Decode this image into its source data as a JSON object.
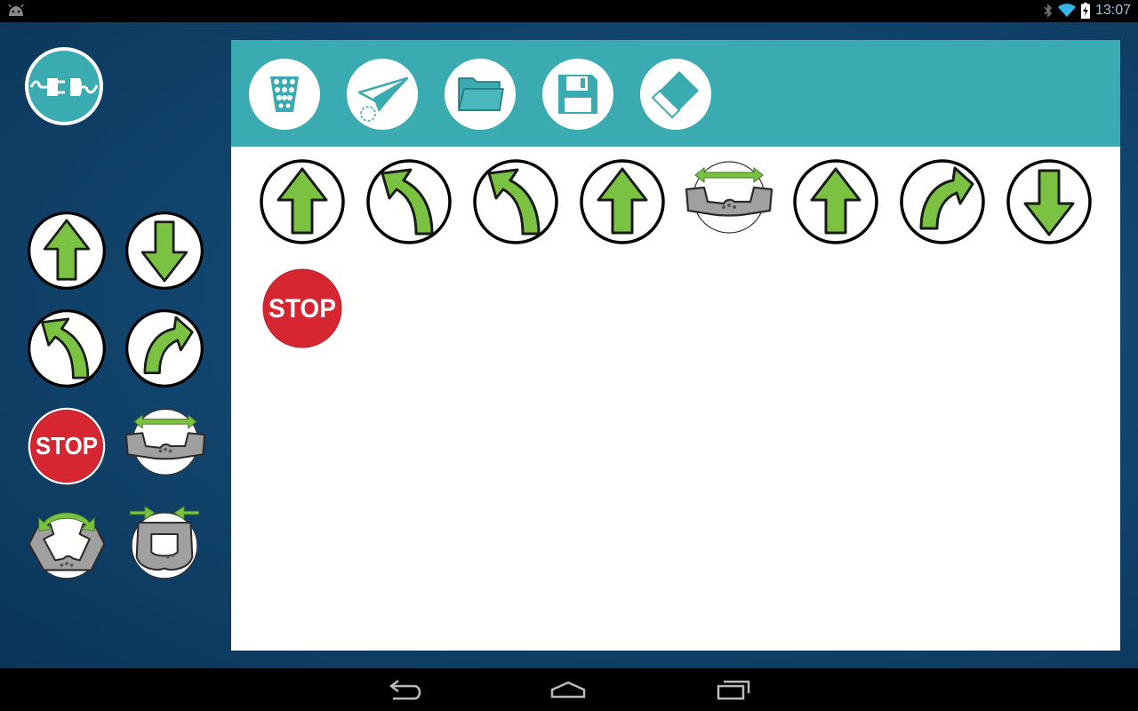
{
  "status_bar": {
    "time": "13:07",
    "icons": [
      "android-icon",
      "bluetooth-icon",
      "wifi-icon",
      "battery-icon"
    ]
  },
  "connect": {
    "icon": "plug-icon"
  },
  "palette": {
    "items": [
      {
        "name": "forward",
        "icon": "arrow-up-icon"
      },
      {
        "name": "backward",
        "icon": "arrow-down-icon"
      },
      {
        "name": "turn-left",
        "icon": "turn-left-icon"
      },
      {
        "name": "turn-right",
        "icon": "turn-right-icon"
      },
      {
        "name": "stop",
        "icon": "stop-icon",
        "label": "STOP"
      },
      {
        "name": "open-arms",
        "icon": "arms-open-icon"
      },
      {
        "name": "raise-arms",
        "icon": "arms-raise-icon"
      },
      {
        "name": "close-arms",
        "icon": "arms-close-icon"
      }
    ]
  },
  "toolbar": {
    "buttons": [
      {
        "name": "clear-program",
        "icon": "trash-icon"
      },
      {
        "name": "send-program",
        "icon": "paper-plane-icon"
      },
      {
        "name": "open-program",
        "icon": "folder-icon"
      },
      {
        "name": "save-program",
        "icon": "floppy-disk-icon"
      },
      {
        "name": "erase",
        "icon": "eraser-icon"
      }
    ]
  },
  "program": {
    "steps": [
      "forward",
      "turn-left",
      "turn-left",
      "forward",
      "open-arms",
      "forward",
      "turn-right",
      "backward",
      "stop"
    ]
  },
  "stop_label": "STOP",
  "colors": {
    "background": "#124770",
    "toolbar": "#3aabb0",
    "arrow_green": "#7cc242",
    "stop_red": "#d62631",
    "arm_gray": "#9a9a9a"
  },
  "nav_bar": {
    "icons": [
      "back-icon",
      "home-icon",
      "recents-icon"
    ]
  }
}
